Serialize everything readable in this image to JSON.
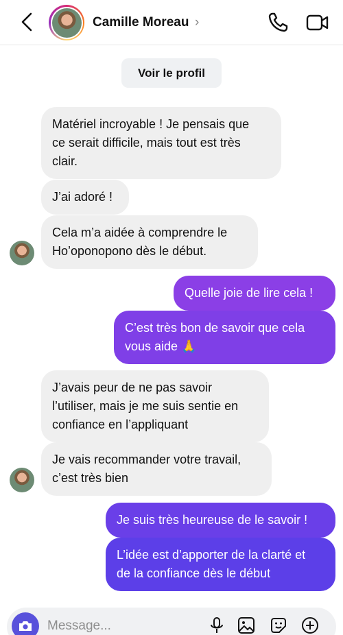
{
  "header": {
    "name": "Camille Moreau",
    "chevron": "›",
    "icons": {
      "back": "chevron-left-icon",
      "call": "phone-icon",
      "video": "video-icon"
    }
  },
  "profile_button": "Voir le profil",
  "messages": [
    {
      "side": "in",
      "text": "Matériel incroyable ! Je pensais que\nce serait difficile, mais tout est très\nclair."
    },
    {
      "side": "in",
      "text": "J’ai adoré !"
    },
    {
      "side": "in",
      "text": "Cela m’a aidée à comprendre le\nHo’oponopono dès le début."
    },
    {
      "side": "out",
      "text": "Quelle joie de lire cela !"
    },
    {
      "side": "out",
      "text": "C’est très bon de savoir que cela\nvous aide 🙏"
    },
    {
      "side": "in",
      "text": "J’avais peur de ne pas savoir\nl’utiliser, mais je me suis sentie en\nconfiance en l’appliquant"
    },
    {
      "side": "in",
      "text": "Je vais recommander votre travail,\nc’est très bien"
    },
    {
      "side": "out",
      "text": "Je suis très heureuse de le savoir !"
    },
    {
      "side": "out",
      "text": "L’idée est d’apporter de la clarté et\nde la confiance dès le début"
    }
  ],
  "composer": {
    "placeholder": "Message...",
    "icons": [
      "camera-icon",
      "microphone-icon",
      "image-icon",
      "sticker-icon",
      "plus-icon"
    ]
  },
  "colors": {
    "out_top": "#9b3fe6",
    "out_bottom": "#5b3fe8",
    "incoming": "#efefef",
    "camera": "#5851db"
  }
}
